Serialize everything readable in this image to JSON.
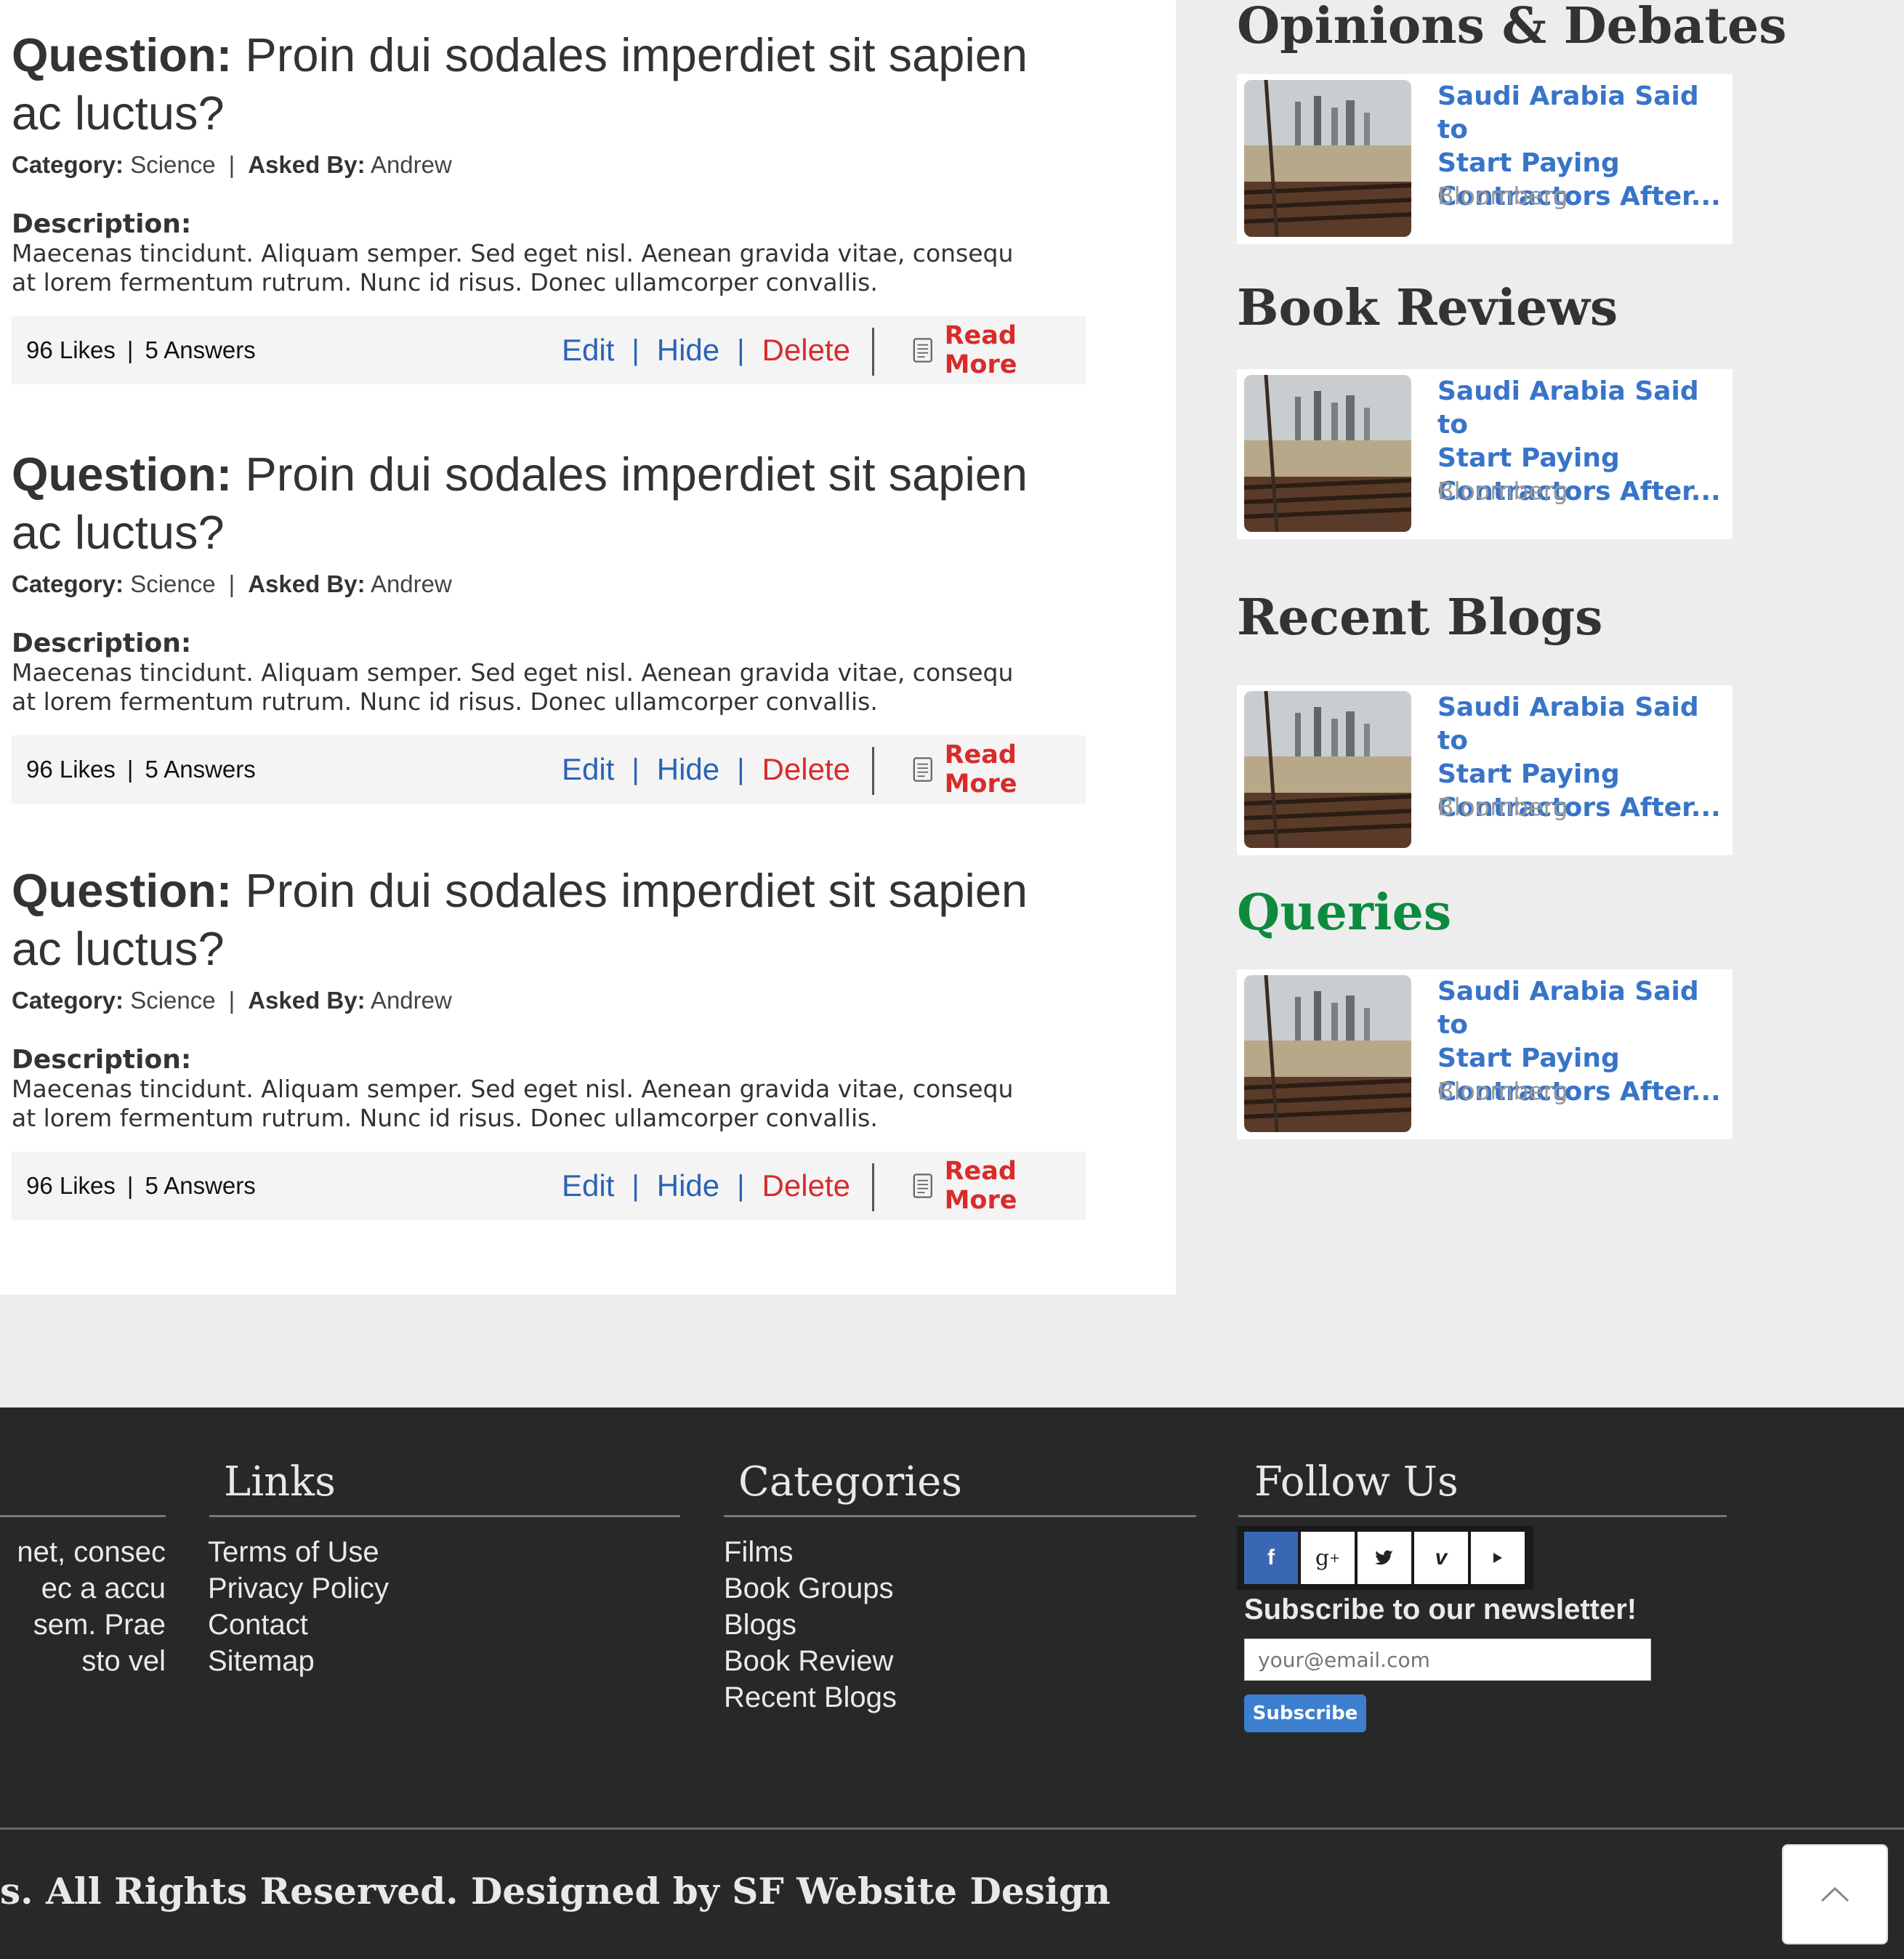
{
  "questions": [
    {
      "label": "Question:",
      "text": "Proin dui sodales imperdiet sit sapien ac luctus?",
      "category_label": "Category:",
      "category": "Science",
      "asked_label": "Asked By:",
      "asked_by": "Andrew",
      "desc_label": "Description:",
      "desc_line1": "Maecenas tincidunt. Aliquam semper. Sed eget nisl. Aenean gravida vitae, consequ",
      "desc_line2": "at lorem fermentum rutrum. Nunc id risus. Donec ullamcorper convallis.",
      "likes": "96 Likes",
      "answers": "5 Answers",
      "edit": "Edit",
      "hide": "Hide",
      "delete": "Delete",
      "read_more": "Read More"
    },
    {
      "label": "Question:",
      "text": "Proin dui sodales imperdiet sit sapien ac luctus?",
      "category_label": "Category:",
      "category": "Science",
      "asked_label": "Asked By:",
      "asked_by": "Andrew",
      "desc_label": "Description:",
      "desc_line1": "Maecenas tincidunt. Aliquam semper. Sed eget nisl. Aenean gravida vitae, consequ",
      "desc_line2": "at lorem fermentum rutrum. Nunc id risus. Donec ullamcorper convallis.",
      "likes": "96 Likes",
      "answers": "5 Answers",
      "edit": "Edit",
      "hide": "Hide",
      "delete": "Delete",
      "read_more": "Read More"
    },
    {
      "label": "Question:",
      "text": "Proin dui sodales imperdiet sit sapien ac luctus?",
      "category_label": "Category:",
      "category": "Science",
      "asked_label": "Asked By:",
      "asked_by": "Andrew",
      "desc_label": "Description:",
      "desc_line1": "Maecenas tincidunt. Aliquam semper. Sed eget nisl. Aenean gravida vitae, consequ",
      "desc_line2": "at lorem fermentum rutrum. Nunc id risus. Donec ullamcorper convallis.",
      "likes": "96 Likes",
      "answers": "5 Answers",
      "edit": "Edit",
      "hide": "Hide",
      "delete": "Delete",
      "read_more": "Read More"
    }
  ],
  "sidebar": {
    "sections": [
      {
        "heading": "Opinions & Debates",
        "title_l1": "Saudi Arabia Said to",
        "title_l2": "Start Paying",
        "title_l3": "Contractors After...",
        "source": "Bloomberg"
      },
      {
        "heading": "Book Reviews",
        "title_l1": "Saudi Arabia Said to",
        "title_l2": "Start Paying",
        "title_l3": "Contractors After...",
        "source": "Bloomberg"
      },
      {
        "heading": "Recent Blogs",
        "title_l1": "Saudi Arabia Said to",
        "title_l2": "Start Paying",
        "title_l3": "Contractors After...",
        "source": "Bloomberg"
      },
      {
        "heading": "Queries",
        "title_l1": "Saudi Arabia Said to",
        "title_l2": "Start Paying",
        "title_l3": "Contractors After...",
        "source": "Bloomberg"
      }
    ],
    "queries_color": "#0d8a3e",
    "link_color": "#3874c8"
  },
  "footer": {
    "about_lines": [
      "net, consec",
      "ec a accu",
      "sem. Prae",
      "sto vel"
    ],
    "links_heading": "Links",
    "links": [
      "Terms of Use",
      "Privacy Policy",
      "Contact",
      "Sitemap"
    ],
    "categories_heading": "Categories",
    "categories": [
      "Films",
      "Book Groups",
      "Blogs",
      "Book Review",
      "Recent Blogs"
    ],
    "follow_heading": "Follow Us",
    "social_icons": [
      "facebook-icon",
      "google-plus-icon",
      "twitter-icon",
      "vimeo-icon",
      "youtube-icon"
    ],
    "newsletter_label": "Subscribe to our newsletter!",
    "email_placeholder": "your@email.com",
    "subscribe_label": "Subscribe",
    "copyright": "s. All Rights Reserved. Designed by SF Website Design"
  }
}
